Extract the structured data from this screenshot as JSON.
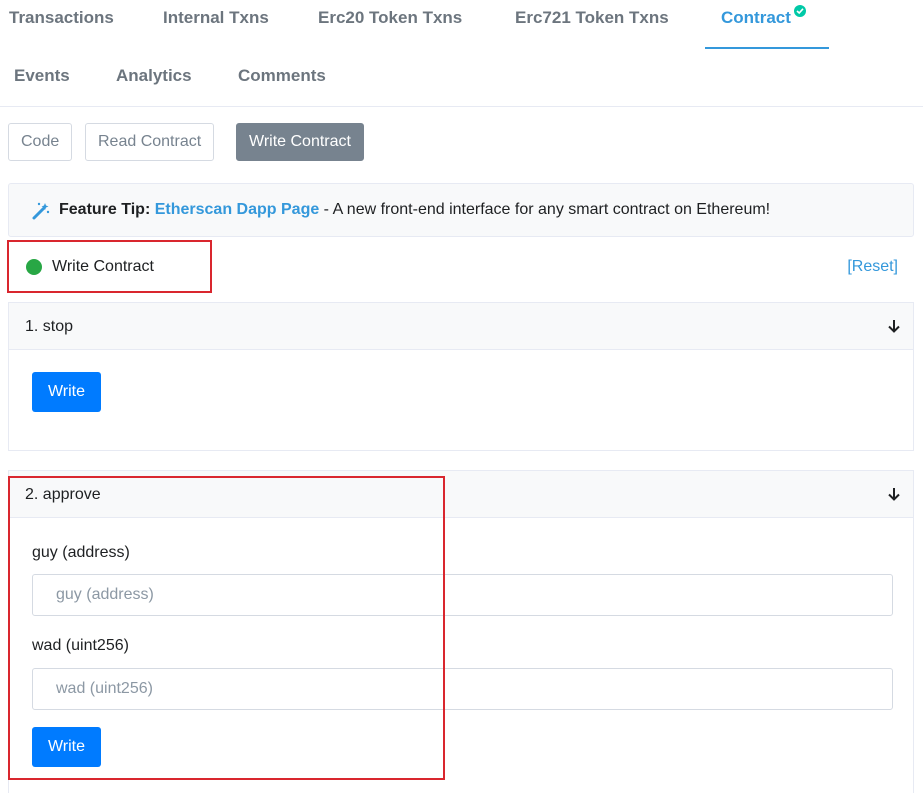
{
  "tabs": [
    {
      "label": "Transactions"
    },
    {
      "label": "Internal Txns"
    },
    {
      "label": "Erc20 Token Txns"
    },
    {
      "label": "Erc721 Token Txns"
    },
    {
      "label": "Contract",
      "active": true
    },
    {
      "label": "Events"
    },
    {
      "label": "Analytics"
    },
    {
      "label": "Comments"
    }
  ],
  "subtabs": {
    "code": "Code",
    "read": "Read Contract",
    "write": "Write Contract"
  },
  "tip": {
    "prefix": "Feature Tip:",
    "link": "Etherscan Dapp Page",
    "text": " - A new front-end interface for any smart contract on Ethereum!"
  },
  "write_contract": {
    "label": "Write Contract",
    "reset": "[Reset]"
  },
  "functions": [
    {
      "title": "1. stop",
      "write_label": "Write"
    },
    {
      "title": "2. approve",
      "write_label": "Write",
      "fields": [
        {
          "label": "guy (address)",
          "placeholder": "guy (address)"
        },
        {
          "label": "wad (uint256)",
          "placeholder": "wad (uint256)"
        }
      ]
    }
  ],
  "colors": {
    "accent": "#3498db",
    "status_dot": "#28a745",
    "write_button": "#007bff",
    "highlight_box": "#d9262e"
  }
}
